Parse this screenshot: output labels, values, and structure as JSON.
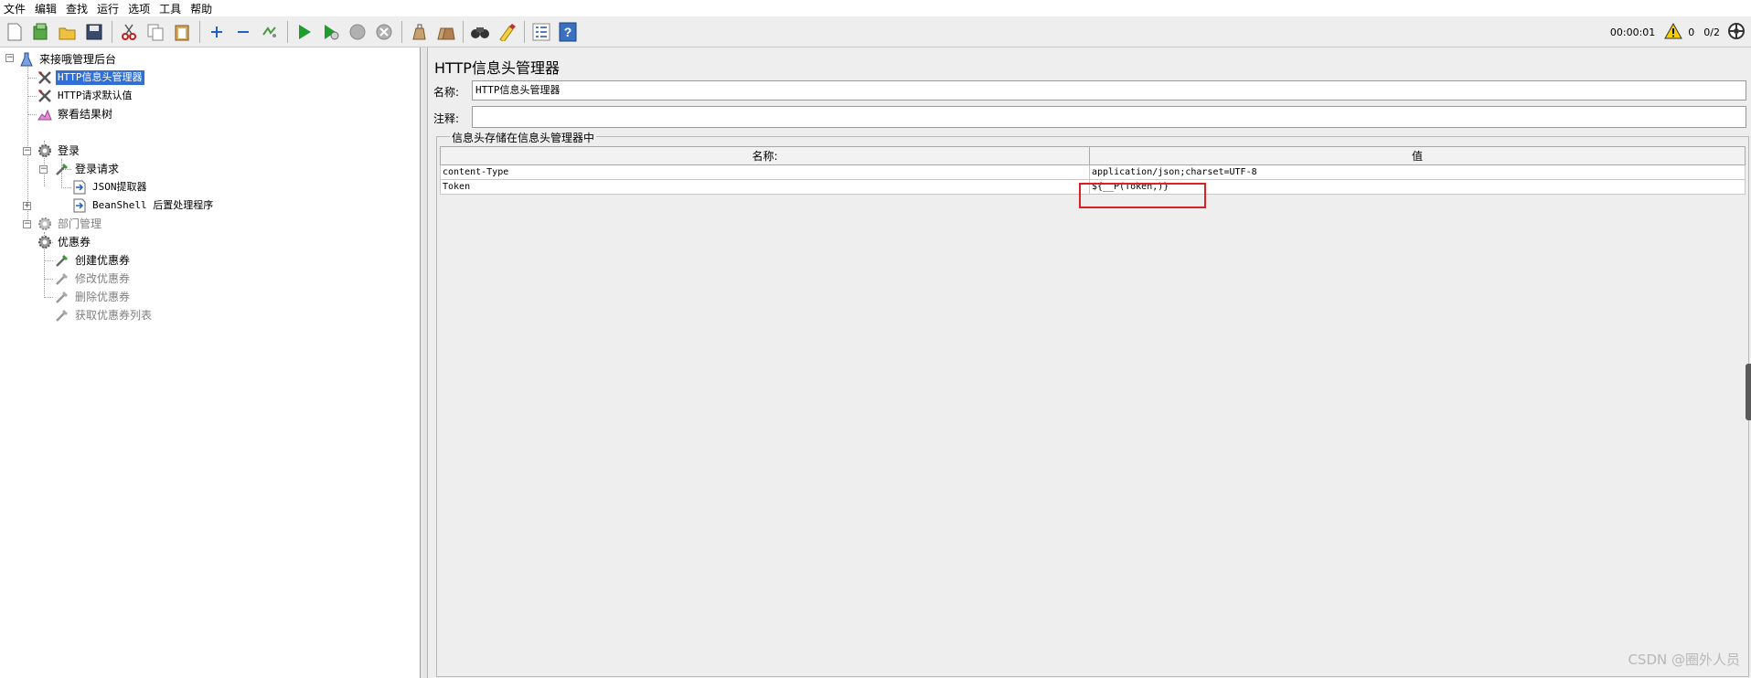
{
  "menu": [
    "文件",
    "编辑",
    "查找",
    "运行",
    "选项",
    "工具",
    "帮助"
  ],
  "status": {
    "time": "00:00:01",
    "warnings": "0",
    "threads": "0/2"
  },
  "tree": {
    "root": "来接哦管理后台",
    "header_manager": "HTTP信息头管理器",
    "request_defaults": "HTTP请求默认值",
    "result_tree": "察看结果树",
    "login_group": "登录",
    "login_request": "登录请求",
    "json_extractor": "JSON提取器",
    "beanshell": "BeanShell 后置处理程序",
    "dept_group": "部门管理",
    "coupon_group": "优惠券",
    "create_coupon": "创建优惠券",
    "edit_coupon": "修改优惠券",
    "delete_coupon": "删除优惠券",
    "list_coupon": "获取优惠券列表"
  },
  "panel": {
    "title": "HTTP信息头管理器",
    "name_label": "名称:",
    "name_value": "HTTP信息头管理器",
    "comment_label": "注释:",
    "comment_value": "",
    "group_title": "信息头存储在信息头管理器中",
    "col_name": "名称:",
    "col_value": "值",
    "rows": [
      {
        "name": "content-Type",
        "value": "application/json;charset=UTF-8"
      },
      {
        "name": "Token",
        "value": "${__P(Token,)}"
      }
    ]
  },
  "watermark": "CSDN @圈外人员",
  "colors": {
    "selection": "#2f6fd6",
    "highlight_box": "#e02020",
    "run_green": "#1e9c2e"
  }
}
